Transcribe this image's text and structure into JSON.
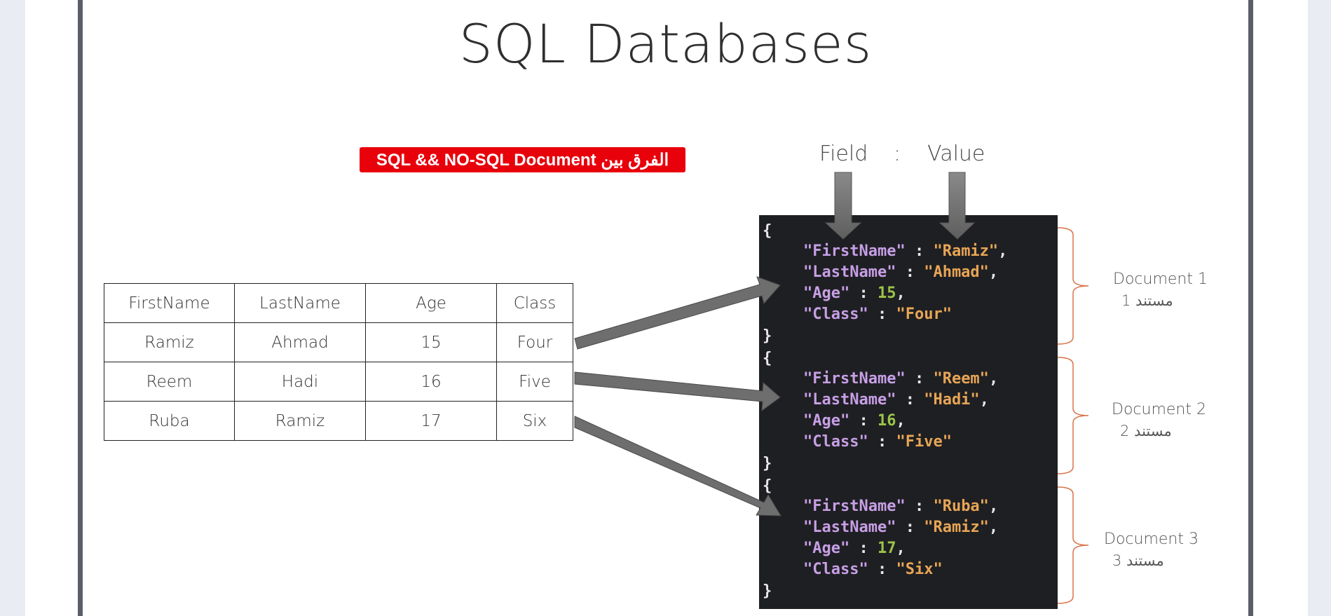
{
  "title": "SQL Databases",
  "note": "الفرق بين SQL && NO-SQL Document",
  "labels": {
    "field": "Field",
    "colon": ":",
    "value": "Value"
  },
  "table": {
    "headers": [
      "FirstName",
      "LastName",
      "Age",
      "Class"
    ],
    "rows": [
      [
        "Ramiz",
        "Ahmad",
        "15",
        "Four"
      ],
      [
        "Reem",
        "Hadi",
        "16",
        "Five"
      ],
      [
        "Ruba",
        "Ramiz",
        "17",
        "Six"
      ]
    ]
  },
  "documents": [
    {
      "label": "Document 1",
      "label_ar": "مستند 1",
      "fields": [
        {
          "key": "\"FirstName\"",
          "value": "\"Ramiz\"",
          "type": "string"
        },
        {
          "key": "\"LastName\"",
          "value": "\"Ahmad\"",
          "type": "string"
        },
        {
          "key": "\"Age\"",
          "value": "15",
          "type": "number"
        },
        {
          "key": "\"Class\"",
          "value": "\"Four\"",
          "type": "string"
        }
      ]
    },
    {
      "label": "Document 2",
      "label_ar": "مستند 2",
      "fields": [
        {
          "key": "\"FirstName\"",
          "value": "\"Reem\"",
          "type": "string"
        },
        {
          "key": "\"LastName\"",
          "value": "\"Hadi\"",
          "type": "string"
        },
        {
          "key": "\"Age\"",
          "value": "16",
          "type": "number"
        },
        {
          "key": "\"Class\"",
          "value": "\"Five\"",
          "type": "string"
        }
      ]
    },
    {
      "label": "Document 3",
      "label_ar": "مستند 3",
      "fields": [
        {
          "key": "\"FirstName\"",
          "value": "\"Ruba\"",
          "type": "string"
        },
        {
          "key": "\"LastName\"",
          "value": "\"Ramiz\"",
          "type": "string"
        },
        {
          "key": "\"Age\"",
          "value": "17",
          "type": "number"
        },
        {
          "key": "\"Class\"",
          "value": "\"Six\"",
          "type": "string"
        }
      ]
    }
  ],
  "colors": {
    "key": "#c79fe6",
    "string": "#e8a556",
    "number": "#9cc44a",
    "code_bg": "#1e1f22",
    "brace": "#d9734a",
    "arrow": "#6b6b6b",
    "badge": "#e8000b"
  }
}
